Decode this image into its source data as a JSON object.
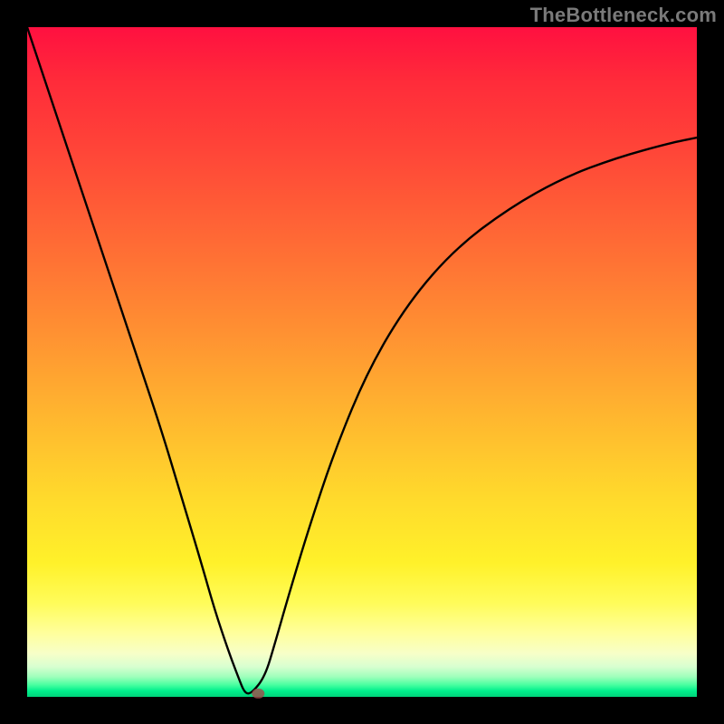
{
  "watermark": "TheBottleneck.com",
  "colors": {
    "frame": "#000000",
    "curve": "#000000",
    "dot": "#a24a4a",
    "gradient_top": "#ff1040",
    "gradient_bottom": "#00d47a"
  },
  "chart_data": {
    "type": "line",
    "title": "",
    "xlabel": "",
    "ylabel": "",
    "xlim": [
      0,
      100
    ],
    "ylim": [
      0,
      100
    ],
    "grid": false,
    "legend": false,
    "annotations": [],
    "x": [
      0,
      4,
      8,
      12,
      16,
      20,
      23,
      26,
      28,
      30,
      31.5,
      32.5,
      33.5,
      35.5,
      37,
      39,
      42,
      46,
      51,
      57,
      64,
      72,
      80,
      88,
      96,
      100
    ],
    "y": [
      100,
      88,
      76,
      64,
      52,
      40,
      30,
      20,
      13,
      7,
      3,
      0.5,
      0.5,
      3,
      8,
      15,
      25,
      37,
      49,
      59,
      67,
      73,
      77.5,
      80.5,
      82.7,
      83.5
    ],
    "notch": {
      "x_start": 30.5,
      "x_end": 34.5,
      "y": 0.5
    },
    "marker": {
      "x": 34.5,
      "y": 0.5
    }
  }
}
